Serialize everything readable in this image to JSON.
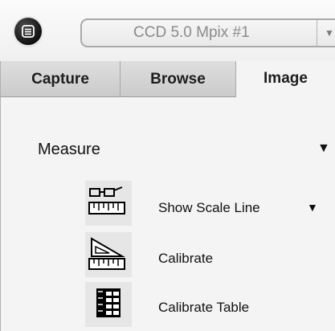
{
  "header": {
    "logo": "app-logo-icon",
    "device_select": {
      "value": "CCD 5.0 Mpix #1",
      "arrow": "▼"
    }
  },
  "tabs": [
    {
      "label": "Capture",
      "active": false
    },
    {
      "label": "Browse",
      "active": false
    },
    {
      "label": "Image",
      "active": true
    }
  ],
  "measure": {
    "title": "Measure",
    "collapse_arrow": "▼",
    "tools": [
      {
        "label": "Show Scale Line",
        "icon": "scale-line-icon",
        "dropdown_arrow": "▼"
      },
      {
        "label": "Calibrate",
        "icon": "calibrate-icon"
      },
      {
        "label": "Calibrate Table",
        "icon": "calibrate-table-icon"
      }
    ]
  }
}
